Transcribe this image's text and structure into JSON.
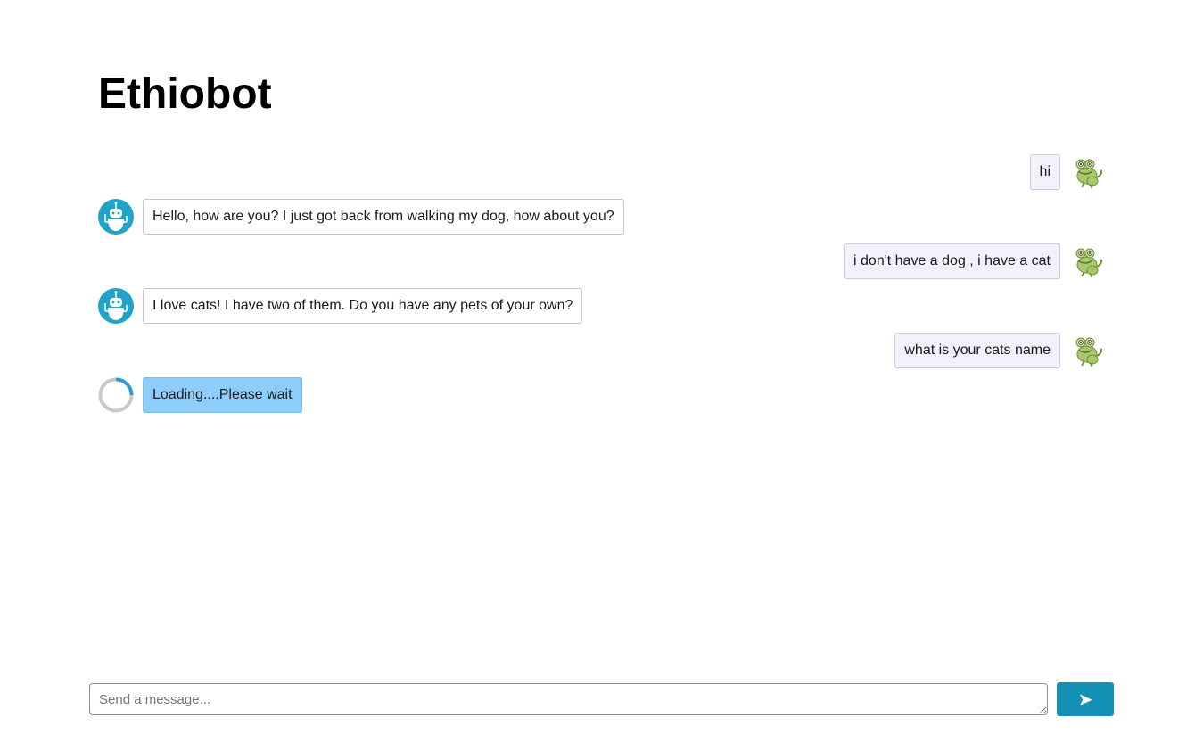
{
  "app": {
    "title": "Ethiobot"
  },
  "messages": [
    {
      "sender": "user",
      "text": "hi",
      "avatar_icon": "frog-avatar-icon"
    },
    {
      "sender": "bot",
      "text": "Hello, how are you? I just got back from walking my dog, how about you?",
      "avatar_icon": "robot-avatar-icon"
    },
    {
      "sender": "user",
      "text": "i don't have a dog , i have a cat",
      "avatar_icon": "frog-avatar-icon"
    },
    {
      "sender": "bot",
      "text": "I love cats! I have two of them. Do you have any pets of your own?",
      "avatar_icon": "robot-avatar-icon"
    },
    {
      "sender": "user",
      "text": "what is your cats name",
      "avatar_icon": "frog-avatar-icon"
    }
  ],
  "loading": {
    "text": "Loading....Please wait",
    "icon": "loading-spinner-icon"
  },
  "composer": {
    "value": "",
    "placeholder": "Send a message...",
    "send_label": "➤",
    "send_icon": "send-arrow-icon"
  },
  "colors": {
    "user_bubble": "#f4f1fd",
    "bot_bubble": "#ffffff",
    "loading_bubble": "#8ccdfb",
    "bot_avatar": "#1fa3c8",
    "frog": "#a8c96a",
    "send_button": "#1490b5"
  }
}
